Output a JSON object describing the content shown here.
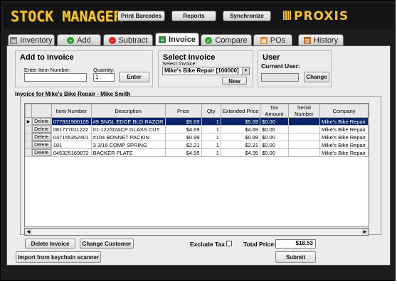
{
  "app": {
    "logo": "STOCK MANAGER",
    "brand": "PROXIS"
  },
  "header_buttons": {
    "print_barcodes": "Print Barcodes",
    "reports": "Reports",
    "synchronize": "Synchronize"
  },
  "tabs": [
    {
      "label": "Inventory",
      "icon": "inventory-icon"
    },
    {
      "label": "Add",
      "icon": "plus-icon"
    },
    {
      "label": "Subtract",
      "icon": "minus-icon"
    },
    {
      "label": "Invoice",
      "icon": "invoice-icon"
    },
    {
      "label": "Compare",
      "icon": "check-icon"
    },
    {
      "label": "POs",
      "icon": "po-icon"
    },
    {
      "label": "History",
      "icon": "history-icon"
    }
  ],
  "active_tab": "Invoice",
  "add_to_invoice": {
    "title": "Add to invoice",
    "item_label": "Enter Item Number:",
    "item_value": "",
    "qty_label": "Quantity:",
    "qty_value": "1",
    "enter_label": "Enter"
  },
  "select_invoice": {
    "title": "Select Invoice",
    "select_label": "Select Invoice:",
    "selected": "Mike's Bike Repair [100000]",
    "new_label": "New"
  },
  "user": {
    "title": "User",
    "current_user_label": "Current User:",
    "current_user_value": "",
    "change_label": "Change"
  },
  "invoice_grid": {
    "title": "Invoice for Mike's Bike Repair - Mike Smith",
    "columns": [
      "",
      "Item Number",
      "Description",
      "Price",
      "Qty",
      "Extended Price",
      "Tax Amount",
      "Serial Number",
      "Company"
    ],
    "delete_label": "Delete",
    "rows": [
      [
        "077931900105",
        "#9 SNGL EDGE BLD RAZOR",
        "$5.69",
        "1",
        "$5.69",
        "$0.00",
        "",
        "Mike's Bike Repair"
      ],
      [
        "081777011222",
        "01-122/02ACP GLASS CUT",
        "$4.69",
        "1",
        "$4.69",
        "$0.00",
        "",
        "Mike's Bike Repair"
      ],
      [
        "037155352401",
        "#104 BONNET PACKIN",
        "$0.99",
        "1",
        "$0.99",
        "$0.00",
        "",
        "Mike's Bike Repair"
      ],
      [
        "181",
        "3 3/16 COMP SPRING",
        "$2.21",
        "1",
        "$2.21",
        "$0.00",
        "",
        "Mike's Bike Repair"
      ],
      [
        "045325169872",
        "BACKER PLATE",
        "$4.95",
        "1",
        "$4.95",
        "$0.00",
        "",
        "Mike's Bike Repair"
      ]
    ]
  },
  "footer": {
    "delete_invoice": "Delete Invoice",
    "change_customer": "Change Customer",
    "exclude_tax_label": "Exclude Tax",
    "total_price_label": "Total Price:",
    "total_price_value": "$18.53",
    "import_label": "Import from keychain scanner",
    "submit_label": "Submit"
  },
  "colors": {
    "accent": "#f2c33a",
    "selection": "#0a246a",
    "frame": "#1c1c1c"
  }
}
